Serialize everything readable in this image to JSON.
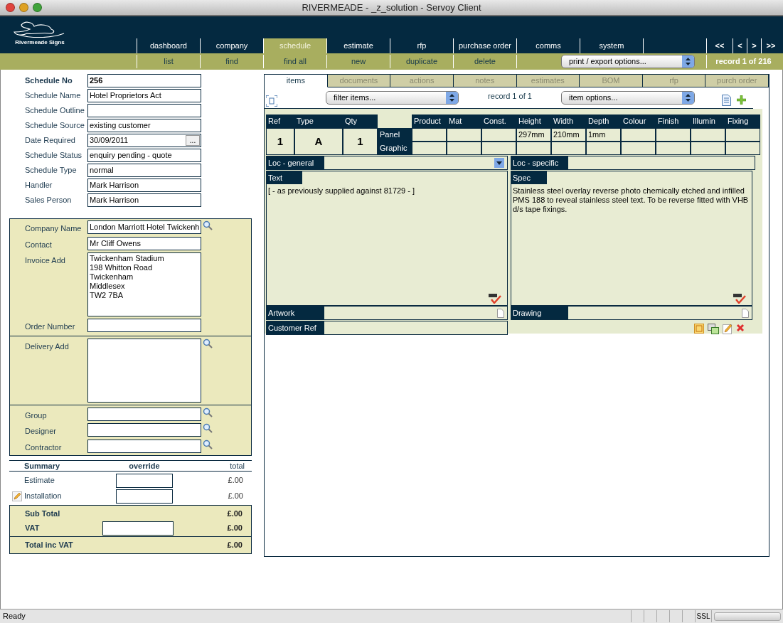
{
  "window": {
    "title": "RIVERMEADE - _z_solution - Servoy Client"
  },
  "header": {
    "logo_text": "Rivermeade Signs",
    "tabs": [
      {
        "label": "dashboard",
        "selected": false
      },
      {
        "label": "company",
        "selected": false
      },
      {
        "label": "schedule",
        "selected": true
      },
      {
        "label": "estimate",
        "selected": false
      },
      {
        "label": "rfp",
        "selected": false
      },
      {
        "label": "purchase order",
        "selected": false
      },
      {
        "label": "comms",
        "selected": false
      },
      {
        "label": "system",
        "selected": false
      }
    ],
    "nav_buttons": [
      "<<",
      "<",
      ">",
      ">>"
    ],
    "actions": [
      "list",
      "find",
      "find all",
      "new",
      "duplicate",
      "delete"
    ],
    "print_dropdown": "print / export options...",
    "record": "record 1 of 216"
  },
  "schedule_fields": [
    {
      "label": "Schedule No",
      "value": "256",
      "kind": "bold"
    },
    {
      "label": "Schedule Name",
      "value": "Hotel Proprietors Act",
      "kind": "text"
    },
    {
      "label": "Schedule Outline",
      "kind": "text"
    },
    {
      "label": "Schedule Source",
      "value": "existing customer",
      "kind": "text"
    },
    {
      "label": "Date Required",
      "value": "30/09/2011",
      "kind": "date",
      "button": "..."
    },
    {
      "label": "Schedule Status",
      "value": "enquiry pending - quote",
      "kind": "text"
    },
    {
      "label": "Schedule Type",
      "value": "normal",
      "kind": "text"
    },
    {
      "label": "Handler",
      "value": "Mark Harrison",
      "kind": "text"
    },
    {
      "label": "Sales Person",
      "value": "Mark Harrison",
      "kind": "text"
    }
  ],
  "company_sections": [
    [
      {
        "label": "Company Name",
        "value": "London Marriott Hotel Twickenh",
        "kind": "text",
        "search": true
      },
      {
        "label": "Contact",
        "value": "Mr Cliff Owens",
        "kind": "text",
        "search": false
      },
      {
        "label": "Invoice Add",
        "lines": [
          "Twickenham Stadium",
          "198 Whitton Road",
          "Twickenham",
          "Middlesex",
          "TW2 7BA"
        ],
        "kind": "area",
        "search": false
      },
      {
        "label": "Order Number",
        "kind": "text",
        "search": false
      }
    ],
    [
      {
        "label": "Delivery Add",
        "kind": "area",
        "search": true
      }
    ],
    [
      {
        "label": "Group",
        "kind": "text",
        "search": true
      },
      {
        "label": "Designer",
        "kind": "text",
        "search": true
      },
      {
        "label": "Contractor",
        "kind": "text",
        "search": true
      }
    ]
  ],
  "summary": {
    "heading": "Summary",
    "override_heading": "override",
    "total_heading": "total",
    "rows": [
      {
        "label": "Estimate",
        "total": "£.00",
        "editable": false
      },
      {
        "label": "Installation",
        "total": "£.00",
        "editable": true
      }
    ],
    "totals": [
      {
        "label": "Sub Total",
        "total": "£.00",
        "override": false
      },
      {
        "label": "VAT",
        "total": "£.00",
        "override": true
      }
    ],
    "grand_total": {
      "label": "Total inc VAT",
      "total": "£.00"
    }
  },
  "items_panel": {
    "tabs": [
      {
        "label": "items",
        "selected": true
      },
      {
        "label": "documents",
        "selected": false
      },
      {
        "label": "actions",
        "selected": false
      },
      {
        "label": "notes",
        "selected": false
      },
      {
        "label": "estimates",
        "selected": false
      },
      {
        "label": "BOM",
        "selected": false
      },
      {
        "label": "rfp",
        "selected": false
      },
      {
        "label": "purch order",
        "selected": false
      }
    ],
    "filter": "filter items...",
    "record": "record 1 of 1",
    "item_options": "item options...",
    "grid": {
      "ref_heading": "Ref",
      "type_heading": "Type",
      "qty_heading": "Qty",
      "ref": "1",
      "type": "A",
      "qty": "1",
      "row_labels": [
        "Panel",
        "Graphic"
      ],
      "columns": [
        {
          "label": "Product"
        },
        {
          "label": "Mat"
        },
        {
          "label": "Const."
        },
        {
          "label": "Height",
          "panel": "297mm"
        },
        {
          "label": "Width",
          "panel": "210mm"
        },
        {
          "label": "Depth",
          "panel": "1mm"
        },
        {
          "label": "Colour"
        },
        {
          "label": "Finish"
        },
        {
          "label": "Illumin"
        },
        {
          "label": "Fixing"
        }
      ]
    },
    "loc_general": "Loc - general",
    "loc_specific": "Loc - specific",
    "text_label": "Text",
    "text": "[ - as previously supplied against 81729 - ]",
    "spec_label": "Spec",
    "spec": "Stainless steel overlay reverse photo chemically etched and infilled PMS 188 to reveal stainless steel text. To be reverse fitted with VHB d/s tape fixings.",
    "artwork_label": "Artwork",
    "drawing_label": "Drawing",
    "customer_ref_label": "Customer Ref"
  },
  "status_bar": {
    "text": "Ready",
    "ssl": "SSL"
  }
}
